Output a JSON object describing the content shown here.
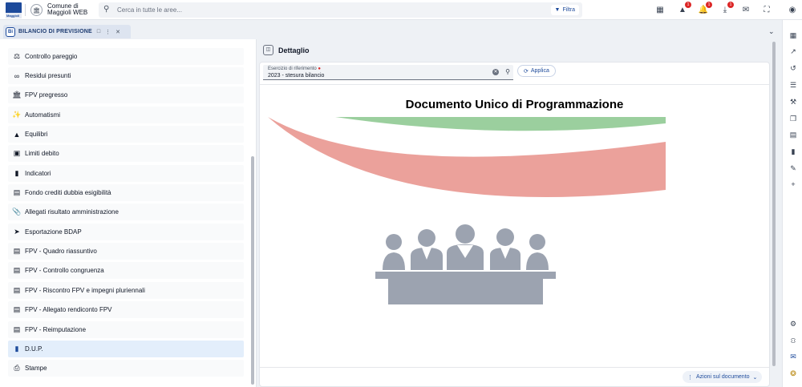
{
  "header": {
    "logo_text": "Maggioli",
    "municipality_name": [
      "Comune di",
      "Maggioli WEB"
    ],
    "search_placeholder": "Cerca in tutte le aree...",
    "filter_label": "Filtra",
    "notifications": {
      "warnings_badge": "1",
      "bell_badge": "1",
      "downloads_badge": "1"
    }
  },
  "tab": {
    "label": "BILANCIO DI PREVISIONE",
    "icon_text": "Bi"
  },
  "menu": {
    "items": [
      {
        "label": "Controllo pareggio",
        "icon": "scale-icon"
      },
      {
        "label": "Residui presunti",
        "icon": "link-icon"
      },
      {
        "label": "FPV pregresso",
        "icon": "bank-icon"
      },
      {
        "label": "Automatismi",
        "icon": "magic-wand-icon"
      },
      {
        "label": "Equilibri",
        "icon": "shapes-icon"
      },
      {
        "label": "Limiti debito",
        "icon": "money-icon"
      },
      {
        "label": "Indicatori",
        "icon": "document-icon"
      },
      {
        "label": "Fondo crediti dubbia esigibilità",
        "icon": "card-icon"
      },
      {
        "label": "Allegati risultato amministrazione",
        "icon": "paperclip-icon"
      },
      {
        "label": "Esportazione BDAP",
        "icon": "send-icon"
      },
      {
        "label": "FPV - Quadro riassuntivo",
        "icon": "card-icon"
      },
      {
        "label": "FPV - Controllo congruenza",
        "icon": "card-icon"
      },
      {
        "label": "FPV - Riscontro FPV e impegni pluriennali",
        "icon": "card-icon"
      },
      {
        "label": "FPV - Allegato rendiconto FPV",
        "icon": "card-icon"
      },
      {
        "label": "FPV - Reimputazione",
        "icon": "card-icon"
      },
      {
        "label": "D.U.P.",
        "icon": "document-icon",
        "active": true
      },
      {
        "label": "Stampe",
        "icon": "printer-icon"
      }
    ]
  },
  "detail": {
    "title": "Dettaglio",
    "field_label": "Esercizio di riferimento",
    "field_value": "2023 - stesura bilancio",
    "apply_label": "Applica",
    "document_title": "Documento Unico di Programmazione",
    "actions_label": "Azioni sul documento"
  },
  "colors": {
    "brand": "#1d4a9b",
    "flag_green": "#9bcf9e",
    "flag_red": "#eba19b",
    "people": "#9ca3b0",
    "active_item": "#e3eefb"
  }
}
